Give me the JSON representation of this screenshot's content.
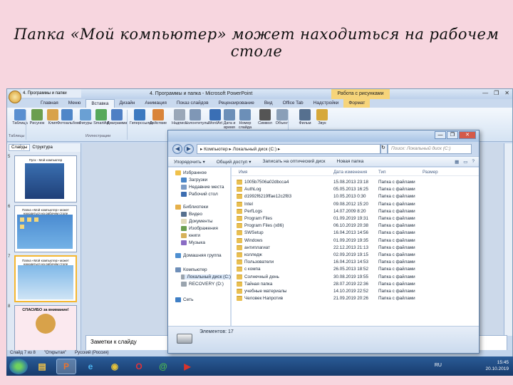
{
  "slide": {
    "title": "Папка «Мой компьютер» может находиться на рабочем столе"
  },
  "powerpoint": {
    "window_title": "4. Программы и папка - Microsoft PowerPoint",
    "context_tab": "Работа с рисунками",
    "ribbon_tabs": [
      "Главная",
      "Меню",
      "Вставка",
      "Дизайн",
      "Анимация",
      "Показ слайдов",
      "Рецензирование",
      "Вид",
      "Office Tab",
      "Надстройки",
      "Формат"
    ],
    "active_tab": "Вставка",
    "ribbon_buttons": [
      "Таблица",
      "Рисунок",
      "Клип",
      "Фотоальбом",
      "Фигуры",
      "SmartArt",
      "Диаграмма",
      "Гиперссылка",
      "Действие",
      "Надпись",
      "Колонтитулы",
      "WordArt",
      "Дата и время",
      "Номер слайда",
      "Символ",
      "Объект",
      "Фильм",
      "Звук"
    ],
    "ribbon_groups": {
      "tables": "Таблицы",
      "illustrations": "Иллюстрации"
    },
    "doc_tab": "4. Программы и папки",
    "pane_tabs": {
      "slides": "Слайды",
      "outline": "Структура"
    },
    "thumbnails": [
      {
        "num": "5",
        "caption": "Пуск - Мой компьютер"
      },
      {
        "num": "6",
        "caption": "Папка «Мой компьютер» может находиться на рабочем столе"
      },
      {
        "num": "7",
        "caption": "Папка «Мой компьютер» может находиться на рабочем столе"
      },
      {
        "num": "8",
        "caption": "СПАСИБО за внимание!"
      }
    ],
    "notes_placeholder": "Заметки к слайду",
    "status": {
      "slide": "Слайд 7 из 8",
      "theme": "\"Открытая\"",
      "lang": "Русский (Россия)"
    }
  },
  "explorer": {
    "address": [
      "Компьютер",
      "Локальный диск (C:)"
    ],
    "search_placeholder": "Поиск: Локальный диск (C:)",
    "commands": [
      "Упорядочить ▾",
      "Общий доступ ▾",
      "Записать на оптический диск",
      "Новая папка"
    ],
    "nav": [
      {
        "label": "Избранное",
        "level": 0,
        "color": "#f0c14a"
      },
      {
        "label": "Загрузки",
        "level": 1,
        "color": "#4a86c8"
      },
      {
        "label": "Недавние места",
        "level": 1,
        "color": "#7a9bc6"
      },
      {
        "label": "Рабочий стол",
        "level": 1,
        "color": "#3d6db0"
      },
      {
        "label": "Библиотеки",
        "level": 0,
        "color": "#e6b04a"
      },
      {
        "label": "Видео",
        "level": 1,
        "color": "#56708f"
      },
      {
        "label": "Документы",
        "level": 1,
        "color": "#e0d9b8"
      },
      {
        "label": "Изображения",
        "level": 1,
        "color": "#6a9e4f"
      },
      {
        "label": "книги",
        "level": 1,
        "color": "#d6b15a"
      },
      {
        "label": "Музыка",
        "level": 1,
        "color": "#8a6cc4"
      },
      {
        "label": "Домашняя группа",
        "level": 0,
        "color": "#4e8fd0"
      },
      {
        "label": "Компьютер",
        "level": 0,
        "color": "#6f8fb8"
      },
      {
        "label": "Локальный диск (C:)",
        "level": 1,
        "color": "#9aa4ae"
      },
      {
        "label": "RECOVERY (D:)",
        "level": 1,
        "color": "#9aa4ae"
      },
      {
        "label": "Сеть",
        "level": 0,
        "color": "#3f7fc5"
      }
    ],
    "columns": [
      "Имя",
      "Дата изменения",
      "Тип",
      "Размер"
    ],
    "files": [
      {
        "name": "1005b7506a02dbcca4",
        "date": "15.08.2013 23:18",
        "type": "Папка с файлами"
      },
      {
        "name": "AuthLog",
        "date": "05.05.2013 16:25",
        "type": "Папка с файлами"
      },
      {
        "name": "d1992f6219ffae12c2f83",
        "date": "10.05.2013 0:30",
        "type": "Папка с файлами"
      },
      {
        "name": "Intel",
        "date": "09.08.2012 15:20",
        "type": "Папка с файлами"
      },
      {
        "name": "PerfLogs",
        "date": "14.07.2009 8:20",
        "type": "Папка с файлами"
      },
      {
        "name": "Program Files",
        "date": "01.09.2019 19:31",
        "type": "Папка с файлами"
      },
      {
        "name": "Program Files (x86)",
        "date": "06.10.2019 20:38",
        "type": "Папка с файлами"
      },
      {
        "name": "SWSetup",
        "date": "16.04.2013 14:56",
        "type": "Папка с файлами"
      },
      {
        "name": "Windows",
        "date": "01.09.2019 19:35",
        "type": "Папка с файлами"
      },
      {
        "name": "антиплагиат",
        "date": "22.12.2013 21:13",
        "type": "Папка с файлами"
      },
      {
        "name": "колледж",
        "date": "02.09.2019 19:15",
        "type": "Папка с файлами"
      },
      {
        "name": "Пользователи",
        "date": "16.04.2013 14:53",
        "type": "Папка с файлами"
      },
      {
        "name": "с компа",
        "date": "26.05.2013 18:52",
        "type": "Папка с файлами"
      },
      {
        "name": "Солнечный день",
        "date": "30.08.2019 19:55",
        "type": "Папка с файлами"
      },
      {
        "name": "Тайная папка",
        "date": "28.07.2019 22:36",
        "type": "Папка с файлами"
      },
      {
        "name": "учебные материалы",
        "date": "14.10.2019 22:52",
        "type": "Папка с файлами"
      },
      {
        "name": "Человек Напротив",
        "date": "21.09.2019 20:26",
        "type": "Папка с файлами"
      }
    ],
    "status_count": "Элементов: 17"
  },
  "taskbar": {
    "lang": "RU",
    "time": "15:45",
    "date": "20.10.2019",
    "apps": [
      {
        "icon": "ie-explorer-folder-icon",
        "glyph": "▤",
        "color": "#f3c54a"
      },
      {
        "icon": "powerpoint-icon",
        "glyph": "P",
        "color": "#e8732f"
      },
      {
        "icon": "internet-explorer-icon",
        "glyph": "e",
        "color": "#4ab3f0"
      },
      {
        "icon": "chrome-icon",
        "glyph": "◉",
        "color": "#e4c23b"
      },
      {
        "icon": "opera-icon",
        "glyph": "O",
        "color": "#e0323a"
      },
      {
        "icon": "messenger-icon",
        "glyph": "@",
        "color": "#4fbf4f"
      },
      {
        "icon": "video-player-icon",
        "glyph": "▶",
        "color": "#d8332b"
      }
    ]
  }
}
